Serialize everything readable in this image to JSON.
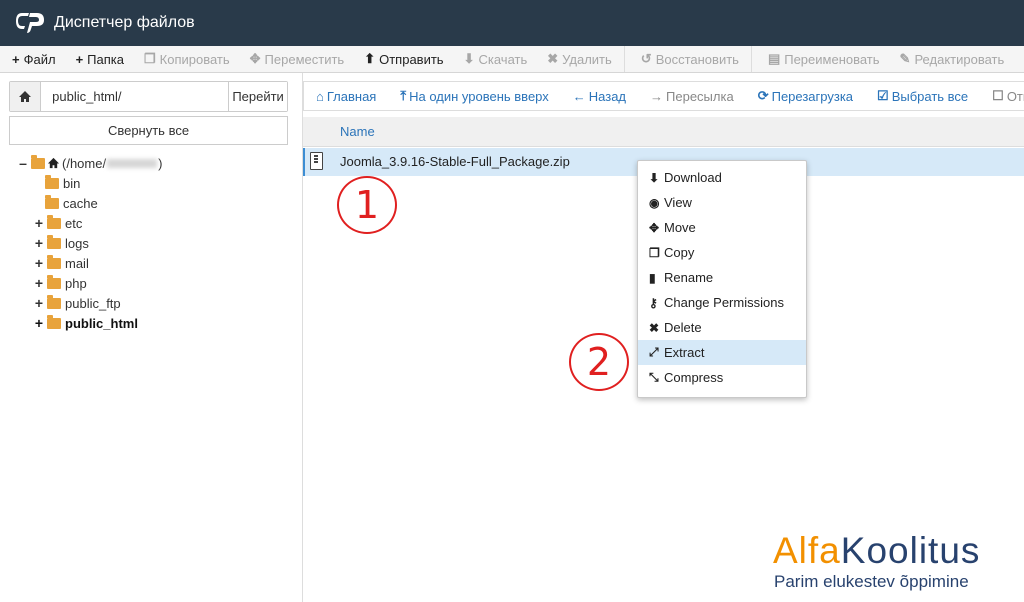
{
  "window": {
    "title": "Диспетчер файлов"
  },
  "toolbar": {
    "items": [
      {
        "icon": "+",
        "label": "Файл",
        "enabled": true
      },
      {
        "icon": "+",
        "label": "Папка",
        "enabled": true
      },
      {
        "icon": "❐",
        "label": "Копировать",
        "enabled": false
      },
      {
        "icon": "✥",
        "label": "Переместить",
        "enabled": false
      },
      {
        "icon": "⬆",
        "label": "Отправить",
        "enabled": true
      },
      {
        "icon": "⬇",
        "label": "Скачать",
        "enabled": false
      },
      {
        "icon": "✖",
        "label": "Удалить",
        "enabled": false
      },
      {
        "icon": "↺",
        "label": "Восстановить",
        "enabled": false
      },
      {
        "icon": "▤",
        "label": "Переименовать",
        "enabled": false
      },
      {
        "icon": "✎",
        "label": "Редактировать",
        "enabled": false
      }
    ]
  },
  "path": {
    "value": "public_html/",
    "go_label": "Перейти"
  },
  "collapse_label": "Свернуть все",
  "tree": {
    "root_label_prefix": "(/home/",
    "root_label_suffix": ")",
    "items": [
      {
        "label": "bin",
        "expandable": false
      },
      {
        "label": "cache",
        "expandable": false
      },
      {
        "label": "etc",
        "expandable": true
      },
      {
        "label": "logs",
        "expandable": true
      },
      {
        "label": "mail",
        "expandable": true
      },
      {
        "label": "php",
        "expandable": true
      },
      {
        "label": "public_ftp",
        "expandable": true
      },
      {
        "label": "public_html",
        "expandable": true,
        "current": true
      }
    ]
  },
  "nav": {
    "items": [
      {
        "icon": "⌂",
        "label": "Главная",
        "enabled": true
      },
      {
        "icon": "⤒",
        "label": "На один уровень вверх",
        "enabled": true
      },
      {
        "icon": "←",
        "label": "Назад",
        "enabled": true
      },
      {
        "icon": "→",
        "label": "Пересылка",
        "enabled": false
      },
      {
        "icon": "⟳",
        "label": "Перезагрузка",
        "enabled": true
      },
      {
        "icon": "☑",
        "label": "Выбрать все",
        "enabled": true
      },
      {
        "icon": "☐",
        "label": "Отм",
        "enabled": false
      }
    ]
  },
  "table": {
    "col_name": "Name"
  },
  "file": {
    "name": "Joomla_3.9.16-Stable-Full_Package.zip"
  },
  "context_menu": {
    "items": [
      {
        "icon": "⬇",
        "label": "Download"
      },
      {
        "icon": "◉",
        "label": "View"
      },
      {
        "icon": "✥",
        "label": "Move"
      },
      {
        "icon": "❐",
        "label": "Copy"
      },
      {
        "icon": "▮",
        "label": "Rename"
      },
      {
        "icon": "⚷",
        "label": "Change Permissions"
      },
      {
        "icon": "✖",
        "label": "Delete"
      },
      {
        "icon": "⤢",
        "label": "Extract",
        "highlighted": true
      },
      {
        "icon": "⤡",
        "label": "Compress"
      }
    ]
  },
  "annotations": {
    "one": "1",
    "two": "2"
  },
  "brand": {
    "part_a": "Alfa",
    "part_k": "Koolitus",
    "tagline": "Parim elukestev õppimine"
  },
  "colors": {
    "titlebar": "#293a4a",
    "link": "#2b74b9",
    "selection": "#d6e9f8",
    "annotation": "#e02020",
    "brand_orange": "#f29000",
    "brand_navy": "#28426e"
  }
}
